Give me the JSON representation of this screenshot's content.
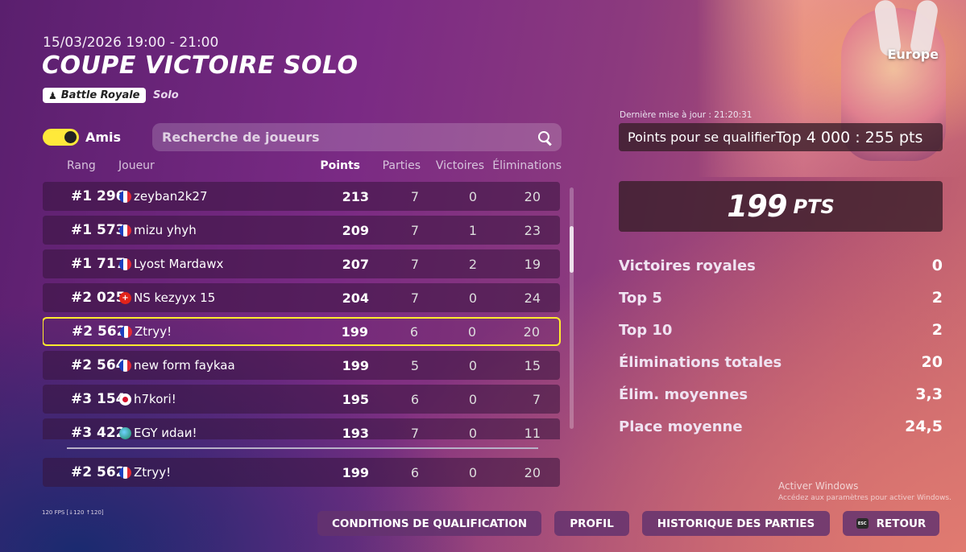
{
  "event": {
    "datetime": "15/03/2026 19:00 - 21:00",
    "title": "COUPE VICTOIRE SOLO",
    "mode_badge": "Battle Royale",
    "mode_sub": "Solo",
    "region": "Europe"
  },
  "filters": {
    "friends_label": "Amis",
    "friends_toggle_on": true,
    "search_placeholder": "Recherche de joueurs"
  },
  "columns": {
    "rank": "Rang",
    "player": "Joueur",
    "points": "Points",
    "games": "Parties",
    "wins": "Victoires",
    "elims": "Éliminations"
  },
  "rows": [
    {
      "rank": "#1 296",
      "flag": "fr",
      "name": "zeyban2k27",
      "points": "213",
      "games": "7",
      "wins": "0",
      "elims": "20",
      "highlight": false
    },
    {
      "rank": "#1 573",
      "flag": "fr",
      "name": "mizu yhyh",
      "points": "209",
      "games": "7",
      "wins": "1",
      "elims": "23",
      "highlight": false
    },
    {
      "rank": "#1 717",
      "flag": "fr",
      "name": "Lyost Mardawx",
      "points": "207",
      "games": "7",
      "wins": "2",
      "elims": "19",
      "highlight": false
    },
    {
      "rank": "#2 025",
      "flag": "ch",
      "name": "NS kezyyx 15",
      "points": "204",
      "games": "7",
      "wins": "0",
      "elims": "24",
      "highlight": false
    },
    {
      "rank": "#2 562",
      "flag": "fr",
      "name": "Ztryy!",
      "points": "199",
      "games": "6",
      "wins": "0",
      "elims": "20",
      "highlight": true
    },
    {
      "rank": "#2 564",
      "flag": "fr",
      "name": "new form faykaa",
      "points": "199",
      "games": "5",
      "wins": "0",
      "elims": "15",
      "highlight": false
    },
    {
      "rank": "#3 154",
      "flag": "jp",
      "name": "h7kori!",
      "points": "195",
      "games": "6",
      "wins": "0",
      "elims": "7",
      "highlight": false
    },
    {
      "rank": "#3 422",
      "flag": "globe",
      "name": "EGY иdaи!",
      "points": "193",
      "games": "7",
      "wins": "0",
      "elims": "11",
      "highlight": false
    }
  ],
  "pinned_row": {
    "rank": "#2 562",
    "flag": "fr",
    "name": "Ztryy!",
    "points": "199",
    "games": "6",
    "wins": "0",
    "elims": "20"
  },
  "scroll_position": 0.2,
  "summary": {
    "last_update": "Dernière mise à jour : 21:20:31",
    "qualify_label": "Points pour se qualifier",
    "qualify_value": "Top 4 000 : 255 pts",
    "points_value": "199",
    "points_unit": "PTS",
    "stats": [
      {
        "label": "Victoires royales",
        "value": "0"
      },
      {
        "label": "Top 5",
        "value": "2"
      },
      {
        "label": "Top 10",
        "value": "2"
      },
      {
        "label": "Éliminations totales",
        "value": "20"
      },
      {
        "label": "Élim. moyennes",
        "value": "3,3"
      },
      {
        "label": "Place moyenne",
        "value": "24,5"
      }
    ]
  },
  "watermark": {
    "title": "Activer Windows",
    "sub": "Accédez aux paramètres pour activer Windows."
  },
  "fps": "120 FPS [↓120 ↑120]",
  "buttons": {
    "conditions": "CONDITIONS DE QUALIFICATION",
    "profile": "PROFIL",
    "history": "HISTORIQUE DES PARTIES",
    "back": "RETOUR",
    "back_key": "ESC"
  },
  "colors": {
    "highlight": "#ffea2e",
    "toggle": "#ffe93a"
  }
}
